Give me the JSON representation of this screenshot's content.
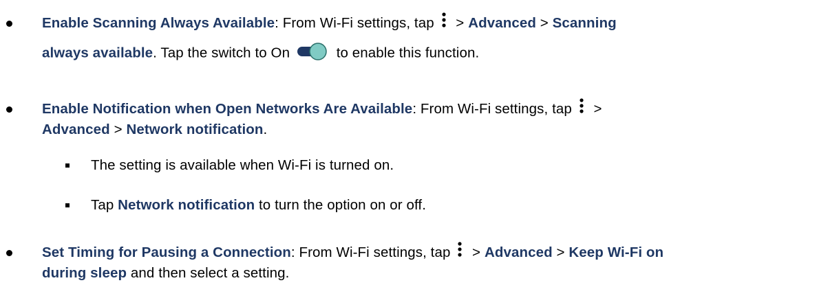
{
  "items": [
    {
      "heading": "Enable Scanning Always Available",
      "line1_text": ": From Wi-Fi settings, tap ",
      "sep1": " > ",
      "advanced": "Advanced",
      "sep2": " > ",
      "target_a": "Scanning",
      "target_b": "always available",
      "line2_text": ". Tap the switch to On ",
      "line2_end": " to enable this function."
    },
    {
      "heading": "Enable Notification when Open Networks Are Available",
      "line1_text": ": From Wi-Fi settings, tap ",
      "sep1": " >",
      "advanced": "Advanced",
      "sep2": " > ",
      "target": "Network notification",
      "end": ".",
      "subitems": [
        {
          "text": "The setting is available when Wi-Fi is turned on."
        },
        {
          "pre": "Tap ",
          "bold": "Network notification",
          "post": " to turn the option on or off."
        }
      ]
    },
    {
      "heading": "Set Timing for Pausing a Connection",
      "line1_text": ": From Wi-Fi settings, tap ",
      "sep1": " > ",
      "advanced": "Advanced",
      "sep2": " > ",
      "target_a": "Keep Wi-Fi on",
      "target_b": "during sleep",
      "end": " and then select a setting."
    }
  ],
  "colors": {
    "heading": "#1f3864",
    "toggle_track": "#1f3864",
    "toggle_knob": "#80cbc4",
    "toggle_knob_border": "#2a6f6a"
  },
  "icons": {
    "menu": "vertical-ellipsis-icon",
    "toggle": "toggle-switch-on-icon"
  }
}
